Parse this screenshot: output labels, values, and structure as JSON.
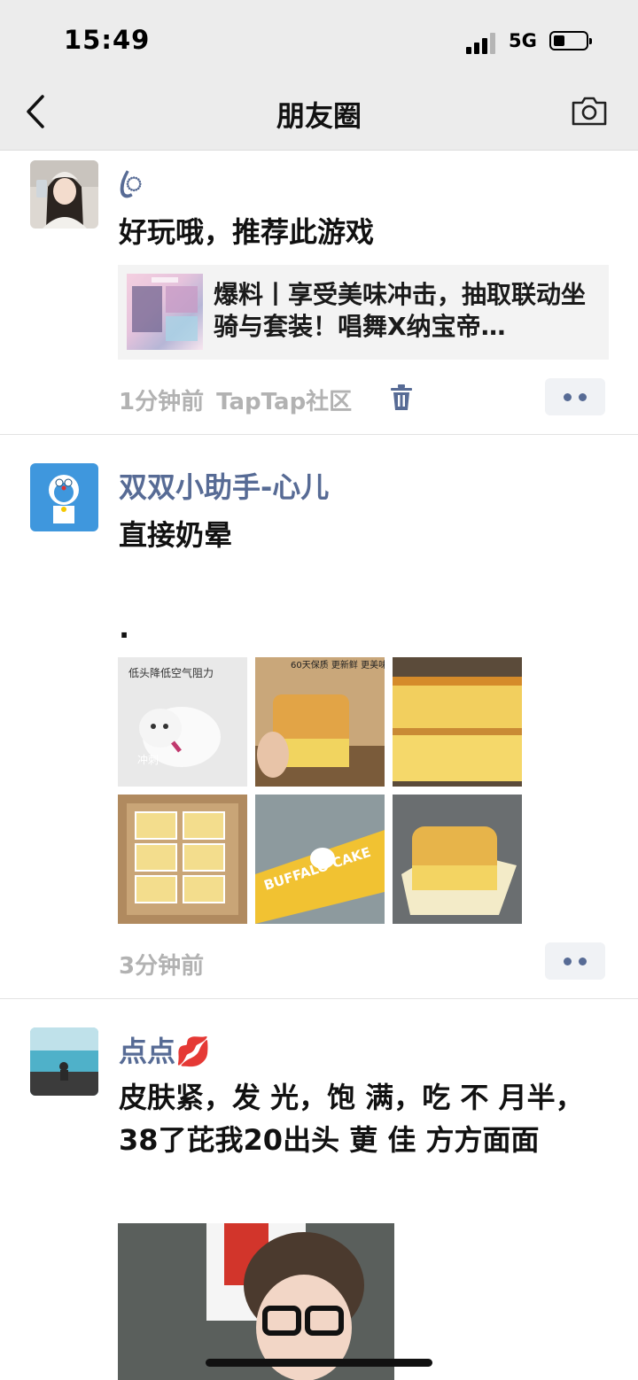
{
  "status_bar": {
    "time": "15:49",
    "network": "5G"
  },
  "nav": {
    "title": "朋友圈"
  },
  "posts": [
    {
      "name": "ꦿ",
      "text": "好玩哦，推荐此游戏",
      "link_title": "爆料丨享受美味冲击，抽取联动坐骑与套装！唱舞Ⅹ纳宝帝…",
      "time": "1分钟前",
      "source": "TapTap社区"
    },
    {
      "name": "双双小助手-心儿",
      "text": "直接奶晕",
      "text2": ".",
      "image_captions": [
        "低头降低空气阻力",
        "冲刺",
        "60天保质 更新鲜 更美味!",
        "BUFFALO CAKE"
      ],
      "time": "3分钟前"
    },
    {
      "name": "点点💋",
      "text": "皮肤紧，发 光，饱 满，吃 不 月半，38了芘我20出头 莄 佳 方方面面"
    }
  ],
  "icons": [
    "back-chevron-icon",
    "camera-icon",
    "trash-icon",
    "more-dots-icon",
    "signal-icon",
    "battery-icon"
  ],
  "colors": {
    "name": "#576b95",
    "meta": "#b2b2b2",
    "navbar": "#ececec"
  }
}
